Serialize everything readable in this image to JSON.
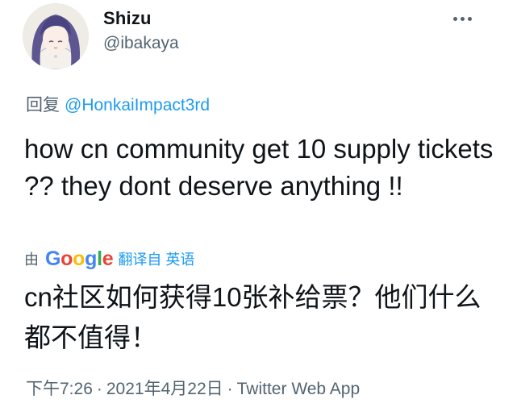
{
  "user": {
    "display_name": "Shizu",
    "handle": "@ibakaya"
  },
  "more_icon": "more-horizontal-icon",
  "reply": {
    "label": "回复",
    "mention": "@HonkaiImpact3rd"
  },
  "tweet": {
    "text": "how cn community get 10 supply tickets ?? they dont deserve anything !!"
  },
  "translation": {
    "by_label": "由",
    "provider": "Google",
    "link_label": "翻译自 英语",
    "translated_text": "cn社区如何获得10张补给票？他们什么都不值得！"
  },
  "meta": {
    "time": "下午7:26",
    "separator": "·",
    "date": "2021年4月22日",
    "source": "Twitter Web App"
  },
  "colors": {
    "text": "#0f1419",
    "secondary": "#536471",
    "link": "#1d9bf0",
    "google_blue": "#4285f4",
    "google_red": "#ea4335",
    "google_yellow": "#fbbc05",
    "google_green": "#34a853"
  }
}
